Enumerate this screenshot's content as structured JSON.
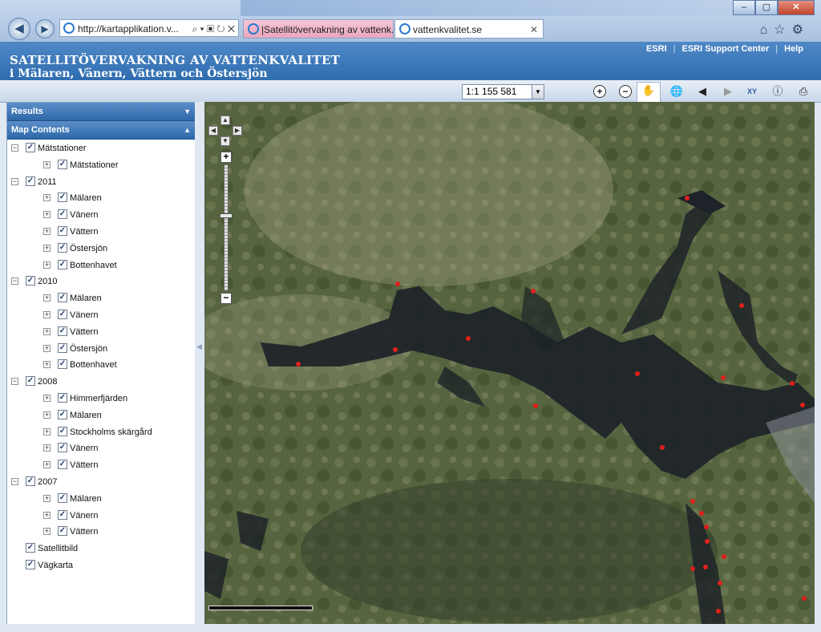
{
  "browser": {
    "address": "http://kartapplikation.v...",
    "tabs": [
      {
        "title": "|Satellitövervakning av vattenk..."
      },
      {
        "title": "vattenkvalitet.se"
      }
    ],
    "window_buttons": {
      "min": "–",
      "max": "▢",
      "close": "✕"
    }
  },
  "header": {
    "title_line1": "SATELLITÖVERVAKNING AV VATTENKVALITET",
    "title_line2": "i Mälaren, Vänern, Vättern och Östersjön",
    "links": [
      "ESRI",
      "ESRI Support Center",
      "Help"
    ]
  },
  "toolbar": {
    "scale": "1:1 155 581",
    "tools": [
      "zoom-in",
      "zoom-out",
      "pan",
      "full-extent",
      "back",
      "forward",
      "xy",
      "identify",
      "print"
    ]
  },
  "panels": {
    "results": "Results",
    "map_contents": "Map Contents"
  },
  "layers": [
    {
      "label": "Mätstationer",
      "level": 0
    },
    {
      "label": "Mätstationer",
      "level": 1
    },
    {
      "label": "2011",
      "level": 0
    },
    {
      "label": "Mälaren",
      "level": 1
    },
    {
      "label": "Vänern",
      "level": 1
    },
    {
      "label": "Vättern",
      "level": 1
    },
    {
      "label": "Östersjön",
      "level": 1
    },
    {
      "label": "Bottenhavet",
      "level": 1
    },
    {
      "label": "2010",
      "level": 0
    },
    {
      "label": "Mälaren",
      "level": 1
    },
    {
      "label": "Vänern",
      "level": 1
    },
    {
      "label": "Vättern",
      "level": 1
    },
    {
      "label": "Östersjön",
      "level": 1
    },
    {
      "label": "Bottenhavet",
      "level": 1
    },
    {
      "label": "2008",
      "level": 0
    },
    {
      "label": "Himmerfjärden",
      "level": 1
    },
    {
      "label": "Mälaren",
      "level": 1
    },
    {
      "label": "Stockholms skärgård",
      "level": 1
    },
    {
      "label": "Vänern",
      "level": 1
    },
    {
      "label": "Vättern",
      "level": 1
    },
    {
      "label": "2007",
      "level": 0
    },
    {
      "label": "Mälaren",
      "level": 1
    },
    {
      "label": "Vänern",
      "level": 1
    },
    {
      "label": "Vättern",
      "level": 1
    },
    {
      "label": "Satellitbild",
      "level": 0,
      "noexpand": true
    },
    {
      "label": "Vägkarta",
      "level": 0,
      "noexpand": true
    }
  ],
  "map": {
    "marker_color": "#e0201c",
    "zoom_level_fraction": 0.6
  }
}
